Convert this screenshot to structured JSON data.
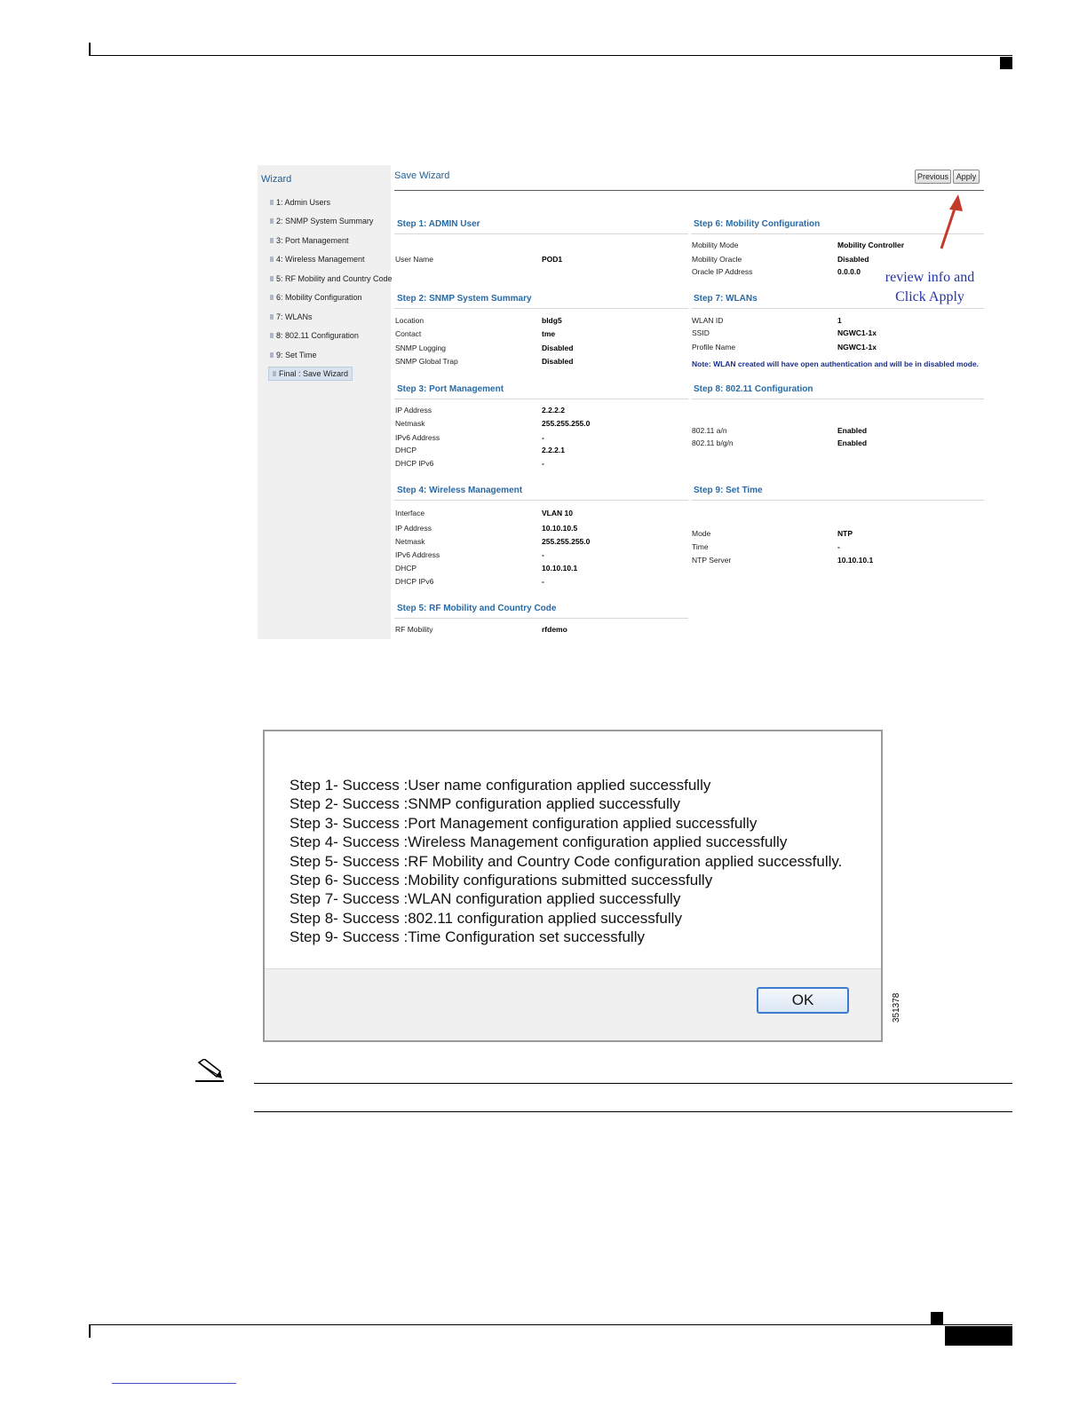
{
  "wizard": {
    "sidebar": {
      "title": "Wizard",
      "items": [
        "1: Admin Users",
        "2: SNMP System Summary",
        "3: Port Management",
        "4: Wireless Management",
        "5: RF Mobility and Country Code",
        "6: Mobility Configuration",
        "7: WLANs",
        "8: 802.11 Configuration",
        "9: Set Time",
        "Final : Save Wizard"
      ],
      "active_index": 9
    },
    "title": "Save Wizard",
    "previous_label": "Previous",
    "apply_label": "Apply",
    "annotation": {
      "line1": "review info and",
      "line2": "Click Apply",
      "arrow_color": "#c23a2a"
    },
    "left": [
      {
        "title": "Step 1: ADMIN User",
        "rows": [
          {
            "label": "User Name",
            "value": "POD1"
          }
        ]
      },
      {
        "title": "Step 2: SNMP System Summary",
        "rows": [
          {
            "label": "Location",
            "value": "bldg5"
          },
          {
            "label": "Contact",
            "value": "tme"
          },
          {
            "label": "SNMP Logging",
            "value": "Disabled"
          },
          {
            "label": "SNMP Global Trap",
            "value": "Disabled"
          }
        ]
      },
      {
        "title": "Step 3: Port Management",
        "rows": [
          {
            "label": "IP Address",
            "value": "2.2.2.2"
          },
          {
            "label": "Netmask",
            "value": "255.255.255.0"
          },
          {
            "label": "IPv6 Address",
            "value": "-"
          },
          {
            "label": "DHCP",
            "value": "2.2.2.1"
          },
          {
            "label": "DHCP IPv6",
            "value": "-"
          }
        ]
      },
      {
        "title": "Step 4: Wireless Management",
        "rows": [
          {
            "label": "Interface",
            "value": "VLAN 10"
          },
          {
            "label": "IP Address",
            "value": "10.10.10.5"
          },
          {
            "label": "Netmask",
            "value": "255.255.255.0"
          },
          {
            "label": "IPv6 Address",
            "value": "-"
          },
          {
            "label": "DHCP",
            "value": "10.10.10.1"
          },
          {
            "label": "DHCP IPv6",
            "value": "-"
          }
        ]
      },
      {
        "title": "Step 5: RF Mobility and Country Code",
        "rows": [
          {
            "label": "RF Mobility",
            "value": "rfdemo"
          }
        ]
      }
    ],
    "right": [
      {
        "title": "Step 6: Mobility Configuration",
        "rows": [
          {
            "label": "Mobility Mode",
            "value": "Mobility Controller"
          },
          {
            "label": "Mobility Oracle",
            "value": "Disabled"
          },
          {
            "label": "Oracle IP Address",
            "value": "0.0.0.0"
          }
        ]
      },
      {
        "title": "Step 7: WLANs",
        "rows": [
          {
            "label": "WLAN ID",
            "value": "1"
          },
          {
            "label": "SSID",
            "value": "NGWC1-1x"
          },
          {
            "label": "Profile Name",
            "value": "NGWC1-1x"
          }
        ],
        "note": "Note: WLAN created will have open authentication and will be in disabled mode."
      },
      {
        "title": "Step 8: 802.11 Configuration",
        "rows": [
          {
            "label": "802.11 a/n",
            "value": "Enabled"
          },
          {
            "label": "802.11 b/g/n",
            "value": "Enabled"
          }
        ]
      },
      {
        "title": "Step 9: Set Time",
        "rows": [
          {
            "label": "Mode",
            "value": "NTP"
          },
          {
            "label": "Time",
            "value": "-"
          },
          {
            "label": "NTP Server",
            "value": "10.10.10.1"
          }
        ]
      }
    ]
  },
  "dialog": {
    "lines": [
      "Step 1- Success :User name configuration applied successfully",
      "Step 2- Success :SNMP configuration applied successfully",
      "Step 3- Success :Port Management configuration applied successfully",
      "Step 4- Success :Wireless Management configuration applied successfully",
      "Step 5- Success :RF Mobility and Country Code configuration applied successfully.",
      "Step 6- Success :Mobility configurations submitted successfully",
      "Step 7- Success :WLAN configuration applied successfully",
      "Step 8- Success :802.11 configuration applied successfully",
      "Step 9- Success :Time Configuration set successfully"
    ],
    "ok_label": "OK"
  },
  "figure_id": "351378"
}
